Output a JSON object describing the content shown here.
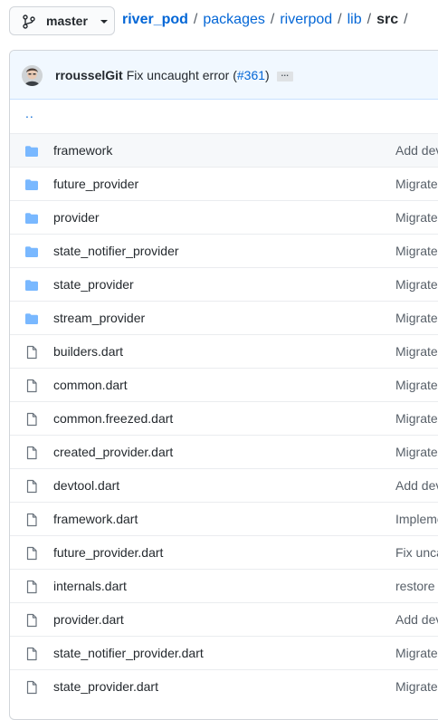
{
  "branch": {
    "label": "master",
    "icon": "git-branch-icon"
  },
  "breadcrumb": {
    "root": "river_pod",
    "parts": [
      "packages",
      "riverpod",
      "lib"
    ],
    "current": "src",
    "separator": "/"
  },
  "commit": {
    "author": "rrousselGit",
    "message": "Fix uncaught error (",
    "issue": "#361",
    "message_end": ")",
    "ellipsis": "…"
  },
  "updir": "..",
  "files": [
    {
      "name": "framework",
      "type": "dir",
      "message": "Add dev"
    },
    {
      "name": "future_provider",
      "type": "dir",
      "message": "Migrate"
    },
    {
      "name": "provider",
      "type": "dir",
      "message": "Migrate"
    },
    {
      "name": "state_notifier_provider",
      "type": "dir",
      "message": "Migrate"
    },
    {
      "name": "state_provider",
      "type": "dir",
      "message": "Migrate"
    },
    {
      "name": "stream_provider",
      "type": "dir",
      "message": "Migrate"
    },
    {
      "name": "builders.dart",
      "type": "file",
      "message": "Migrate"
    },
    {
      "name": "common.dart",
      "type": "file",
      "message": "Migrate"
    },
    {
      "name": "common.freezed.dart",
      "type": "file",
      "message": "Migrate"
    },
    {
      "name": "created_provider.dart",
      "type": "file",
      "message": "Migrate"
    },
    {
      "name": "devtool.dart",
      "type": "file",
      "message": "Add dev"
    },
    {
      "name": "framework.dart",
      "type": "file",
      "message": "Impleme"
    },
    {
      "name": "future_provider.dart",
      "type": "file",
      "message": "Fix unca"
    },
    {
      "name": "internals.dart",
      "type": "file",
      "message": "restore"
    },
    {
      "name": "provider.dart",
      "type": "file",
      "message": "Add dev"
    },
    {
      "name": "state_notifier_provider.dart",
      "type": "file",
      "message": "Migrate"
    },
    {
      "name": "state_provider.dart",
      "type": "file",
      "message": "Migrate"
    }
  ],
  "colors": {
    "link": "#0366d6",
    "folder": "#79b8ff",
    "file_icon": "#6a737d",
    "commit_bg": "#f1f8ff",
    "hover_row": "#f6f8fa"
  }
}
